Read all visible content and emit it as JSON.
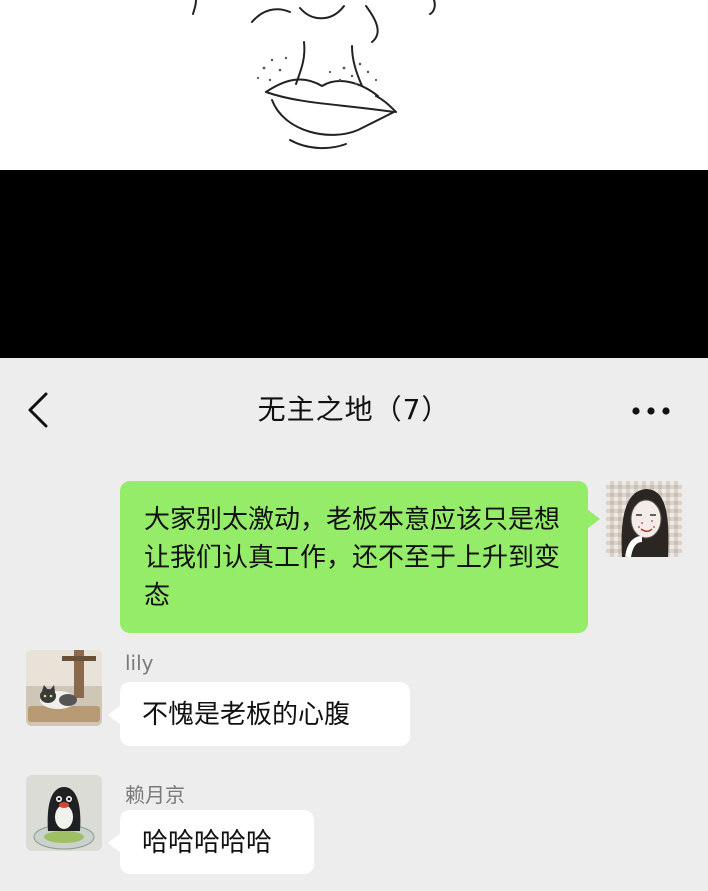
{
  "chat": {
    "title": "无主之地（7）",
    "back_icon": "chevron-left-icon",
    "more_icon": "more-dots-icon"
  },
  "messages": [
    {
      "sender": "",
      "is_self": true,
      "text": "大家别太激动，老板本意应该只是想让我们认真工作，还不至于上升到变态",
      "avatar": "woman-portrait-avatar"
    },
    {
      "sender": "lily",
      "is_self": false,
      "text": "不愧是老板的心腹",
      "avatar": "cat-avatar"
    },
    {
      "sender": "赖月京",
      "is_self": false,
      "text": "哈哈哈哈哈",
      "avatar": "penguin-avatar"
    }
  ],
  "colors": {
    "self_bubble": "#95ec69",
    "other_bubble": "#ffffff",
    "chat_background": "#ededed",
    "sender_name": "#7a7a7a"
  }
}
